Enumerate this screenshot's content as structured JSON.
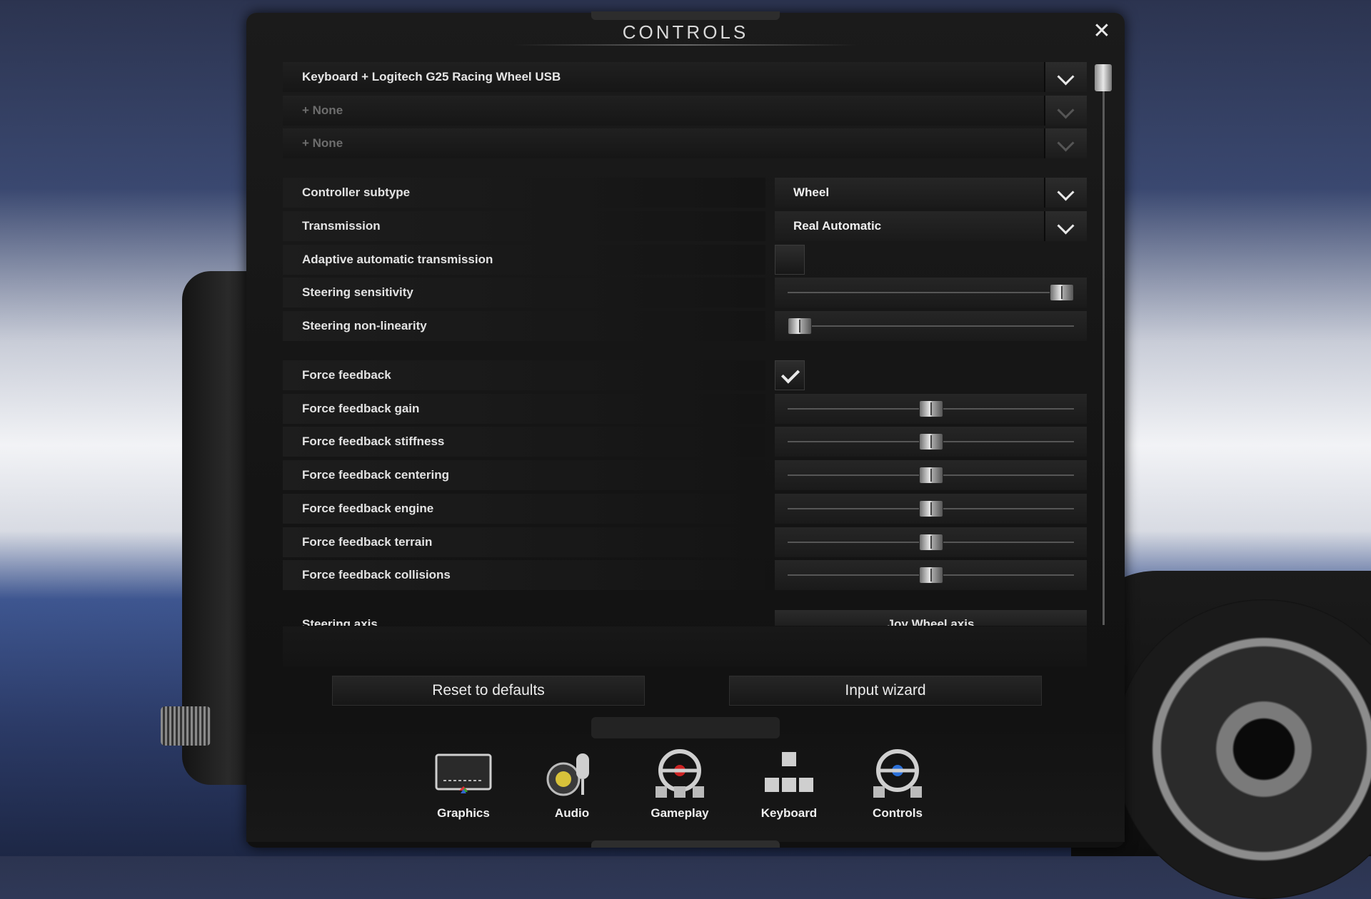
{
  "window": {
    "title": "CONTROLS",
    "close_icon": "close-icon"
  },
  "profiles": [
    {
      "label": "Keyboard + Logitech G25 Racing Wheel USB",
      "enabled": true
    },
    {
      "label": "+ None",
      "enabled": false
    },
    {
      "label": "+ None",
      "enabled": false
    }
  ],
  "settings": {
    "controller_subtype": {
      "label": "Controller subtype",
      "value": "Wheel"
    },
    "transmission": {
      "label": "Transmission",
      "value": "Real Automatic"
    },
    "adaptive": {
      "label": "Adaptive automatic transmission",
      "checked": false
    },
    "steering_sensitivity": {
      "label": "Steering sensitivity",
      "level": 1.0
    },
    "steering_nonlinearity": {
      "label": "Steering non-linearity",
      "level": 0.0
    },
    "force_feedback": {
      "label": "Force feedback",
      "checked": true
    },
    "ff_gain": {
      "label": "Force feedback gain",
      "level": 0.5
    },
    "ff_stiffness": {
      "label": "Force feedback stiffness",
      "level": 0.5
    },
    "ff_centering": {
      "label": "Force feedback centering",
      "level": 0.5
    },
    "ff_engine": {
      "label": "Force feedback engine",
      "level": 0.5
    },
    "ff_terrain": {
      "label": "Force feedback terrain",
      "level": 0.5
    },
    "ff_collisions": {
      "label": "Force feedback collisions",
      "level": 0.5
    },
    "steering_axis": {
      "label": "Steering axis",
      "value": "Joy Wheel axis"
    }
  },
  "buttons": {
    "reset": "Reset to defaults",
    "wizard": "Input wizard"
  },
  "tabs": [
    {
      "label": "Graphics",
      "icon": "monitor-icon"
    },
    {
      "label": "Audio",
      "icon": "speaker-microphone-icon"
    },
    {
      "label": "Gameplay",
      "icon": "steering-wheel-icon"
    },
    {
      "label": "Keyboard",
      "icon": "keys-icon"
    },
    {
      "label": "Controls",
      "icon": "wheel-pedals-icon",
      "active": true
    }
  ]
}
